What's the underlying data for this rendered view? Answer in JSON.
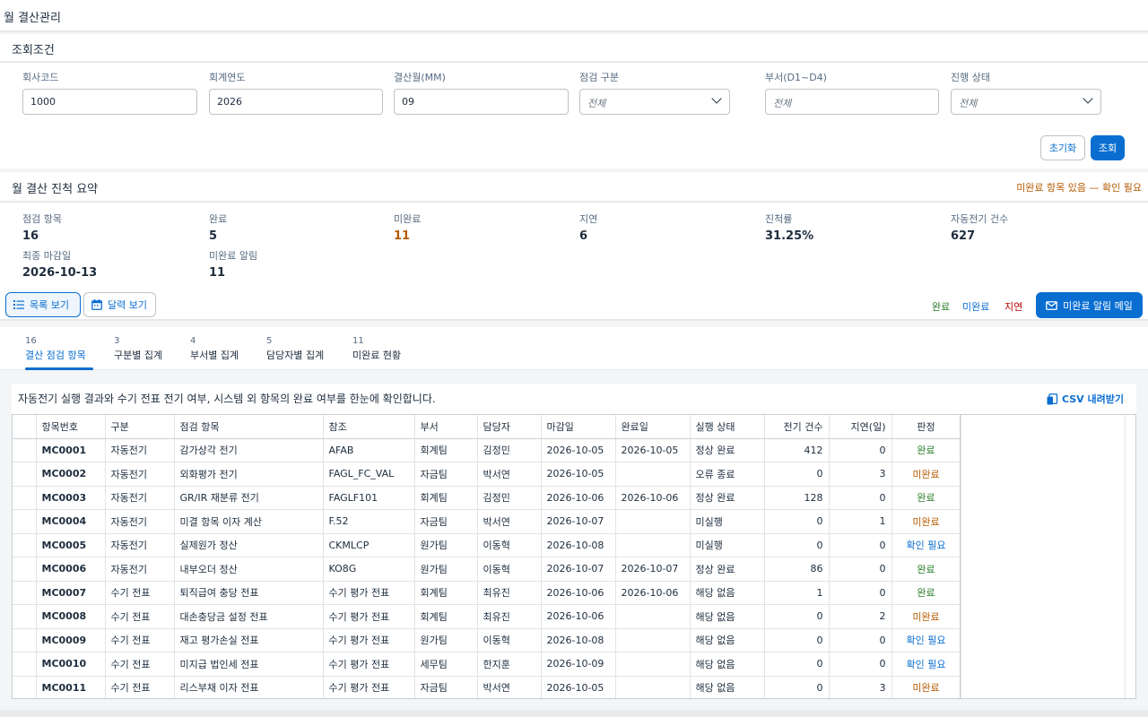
{
  "page": {
    "title": "월 결산관리"
  },
  "filter": {
    "header": "조회조건",
    "fields": {
      "company_code": {
        "label": "회사코드",
        "value": "1000"
      },
      "fiscal_year": {
        "label": "회계연도",
        "value": "2026"
      },
      "closing_month": {
        "label": "결산월(MM)",
        "value": "09"
      },
      "check_type": {
        "label": "점검 구분",
        "value": "전체"
      },
      "department": {
        "label": "부서(D1~D4)",
        "placeholder": "전체"
      },
      "progress_status": {
        "label": "진행 상태",
        "value": "전체"
      }
    },
    "reset_label": "초기화",
    "search_label": "조회"
  },
  "summary": {
    "title": "월 결산 진척 요약",
    "warning": "미완료 항목 있음 — 확인 필요",
    "kpis": {
      "check_items": {
        "label": "점검 항목",
        "value": "16"
      },
      "completed": {
        "label": "완료",
        "value": "5"
      },
      "incomplete": {
        "label": "미완료",
        "value": "11"
      },
      "delayed": {
        "label": "지연",
        "value": "6"
      },
      "progress_rate": {
        "label": "진척률",
        "value": "31.25%"
      },
      "auto_posting_count": {
        "label": "자동전기 건수",
        "value": "627"
      },
      "final_deadline": {
        "label": "최종 마감일",
        "value": "2026-10-13"
      },
      "incomplete_alerts": {
        "label": "미완료 알림",
        "value": "11"
      }
    },
    "view_list_label": "목록 보기",
    "view_calendar_label": "달력 보기",
    "legend": {
      "complete": "완료",
      "incomplete": "미완료",
      "delayed": "지연"
    },
    "mail_button_label": "미완료 알림 메일"
  },
  "colors": {
    "accent": "#0a6ed1",
    "complete": "#2b7d2b",
    "incomplete": "#b55a00",
    "confirm": "#0a6ed1",
    "delayed": "#bb0000",
    "legend_incomplete": "#0a6ed1"
  },
  "tabs": [
    {
      "count": "16",
      "label": "결산 점검 항목"
    },
    {
      "count": "3",
      "label": "구분별 집계"
    },
    {
      "count": "4",
      "label": "부서별 집계"
    },
    {
      "count": "5",
      "label": "담당자별 집계"
    },
    {
      "count": "11",
      "label": "미완료 현황"
    }
  ],
  "table": {
    "description": "자동전기 실행 결과와 수기 전표 전기 여부, 시스템 외 항목의 완료 여부를 한눈에 확인합니다.",
    "csv_label": "CSV 내려받기",
    "columns": [
      "항목번호",
      "구분",
      "점검 항목",
      "참조",
      "부서",
      "담당자",
      "마감일",
      "완료일",
      "실행 상태",
      "전기 건수",
      "지연(일)",
      "판정"
    ],
    "rows": [
      {
        "id": "MC0001",
        "type": "자동전기",
        "item": "감가상각 전기",
        "ref": "AFAB",
        "dept": "회계팀",
        "owner": "김정민",
        "due": "2026-10-05",
        "done": "2026-10-05",
        "exec": "정상 완료",
        "count": "412",
        "delay": "0",
        "verdict": "완료",
        "verdict_kind": "complete"
      },
      {
        "id": "MC0002",
        "type": "자동전기",
        "item": "외화평가 전기",
        "ref": "FAGL_FC_VAL",
        "dept": "자금팀",
        "owner": "박서연",
        "due": "2026-10-05",
        "done": "",
        "exec": "오류 종료",
        "count": "0",
        "delay": "3",
        "verdict": "미완료",
        "verdict_kind": "incomplete"
      },
      {
        "id": "MC0003",
        "type": "자동전기",
        "item": "GR/IR 재분류 전기",
        "ref": "FAGLF101",
        "dept": "회계팀",
        "owner": "김정민",
        "due": "2026-10-06",
        "done": "2026-10-06",
        "exec": "정상 완료",
        "count": "128",
        "delay": "0",
        "verdict": "완료",
        "verdict_kind": "complete"
      },
      {
        "id": "MC0004",
        "type": "자동전기",
        "item": "미결 항목 이자 계산",
        "ref": "F.52",
        "dept": "자금팀",
        "owner": "박서연",
        "due": "2026-10-07",
        "done": "",
        "exec": "미실행",
        "count": "0",
        "delay": "1",
        "verdict": "미완료",
        "verdict_kind": "incomplete"
      },
      {
        "id": "MC0005",
        "type": "자동전기",
        "item": "실제원가 정산",
        "ref": "CKMLCP",
        "dept": "원가팀",
        "owner": "이동혁",
        "due": "2026-10-08",
        "done": "",
        "exec": "미실행",
        "count": "0",
        "delay": "0",
        "verdict": "확인 필요",
        "verdict_kind": "confirm"
      },
      {
        "id": "MC0006",
        "type": "자동전기",
        "item": "내부오더 정산",
        "ref": "KO8G",
        "dept": "원가팀",
        "owner": "이동혁",
        "due": "2026-10-07",
        "done": "2026-10-07",
        "exec": "정상 완료",
        "count": "86",
        "delay": "0",
        "verdict": "완료",
        "verdict_kind": "complete"
      },
      {
        "id": "MC0007",
        "type": "수기 전표",
        "item": "퇴직급여 충당 전표",
        "ref": "수기 평가 전표",
        "dept": "회계팀",
        "owner": "최유진",
        "due": "2026-10-06",
        "done": "2026-10-06",
        "exec": "해당 없음",
        "count": "1",
        "delay": "0",
        "verdict": "완료",
        "verdict_kind": "complete"
      },
      {
        "id": "MC0008",
        "type": "수기 전표",
        "item": "대손충당금 설정 전표",
        "ref": "수기 평가 전표",
        "dept": "회계팀",
        "owner": "최유진",
        "due": "2026-10-06",
        "done": "",
        "exec": "해당 없음",
        "count": "0",
        "delay": "2",
        "verdict": "미완료",
        "verdict_kind": "incomplete"
      },
      {
        "id": "MC0009",
        "type": "수기 전표",
        "item": "재고 평가손실 전표",
        "ref": "수기 평가 전표",
        "dept": "원가팀",
        "owner": "이동혁",
        "due": "2026-10-08",
        "done": "",
        "exec": "해당 없음",
        "count": "0",
        "delay": "0",
        "verdict": "확인 필요",
        "verdict_kind": "confirm"
      },
      {
        "id": "MC0010",
        "type": "수기 전표",
        "item": "미지급 법인세 전표",
        "ref": "수기 평가 전표",
        "dept": "세무팀",
        "owner": "한지훈",
        "due": "2026-10-09",
        "done": "",
        "exec": "해당 없음",
        "count": "0",
        "delay": "0",
        "verdict": "확인 필요",
        "verdict_kind": "confirm"
      },
      {
        "id": "MC0011",
        "type": "수기 전표",
        "item": "리스부채 이자 전표",
        "ref": "수기 평가 전표",
        "dept": "자금팀",
        "owner": "박서연",
        "due": "2026-10-05",
        "done": "",
        "exec": "해당 없음",
        "count": "0",
        "delay": "3",
        "verdict": "미완료",
        "verdict_kind": "incomplete"
      }
    ]
  }
}
